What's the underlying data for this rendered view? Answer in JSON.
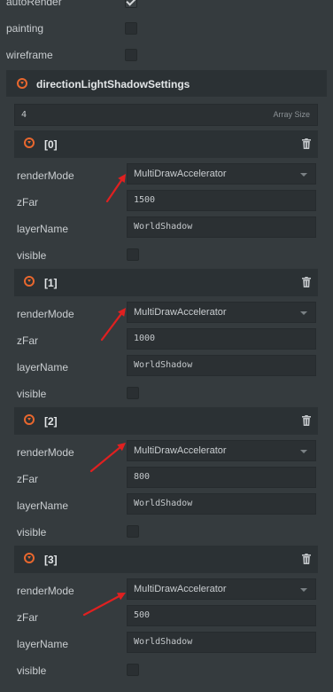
{
  "top": {
    "auto_render_label": "autoRender",
    "painting_label": "painting",
    "wireframe_label": "wireframe"
  },
  "section": {
    "title": "directionLightShadowSettings",
    "array_count": "4",
    "array_size_label": "Array Size"
  },
  "field_labels": {
    "render_mode": "renderMode",
    "z_far": "zFar",
    "layer_name": "layerName",
    "visible": "visible"
  },
  "items": [
    {
      "index": "[0]",
      "render_mode": "MultiDrawAccelerator",
      "z_far": "1500",
      "layer_name": "WorldShadow"
    },
    {
      "index": "[1]",
      "render_mode": "MultiDrawAccelerator",
      "z_far": "1000",
      "layer_name": "WorldShadow"
    },
    {
      "index": "[2]",
      "render_mode": "MultiDrawAccelerator",
      "z_far": "800",
      "layer_name": "WorldShadow"
    },
    {
      "index": "[3]",
      "render_mode": "MultiDrawAccelerator",
      "z_far": "500",
      "layer_name": "WorldShadow"
    }
  ],
  "colors": {
    "accent": "#e8672e",
    "arrow": "#e02020",
    "background": "#353b3e",
    "header": "#2b3134"
  },
  "icons": [
    "collapse-circle-icon",
    "trash-icon",
    "dropdown-caret-icon",
    "checkbox-icon",
    "annotation-arrow"
  ]
}
